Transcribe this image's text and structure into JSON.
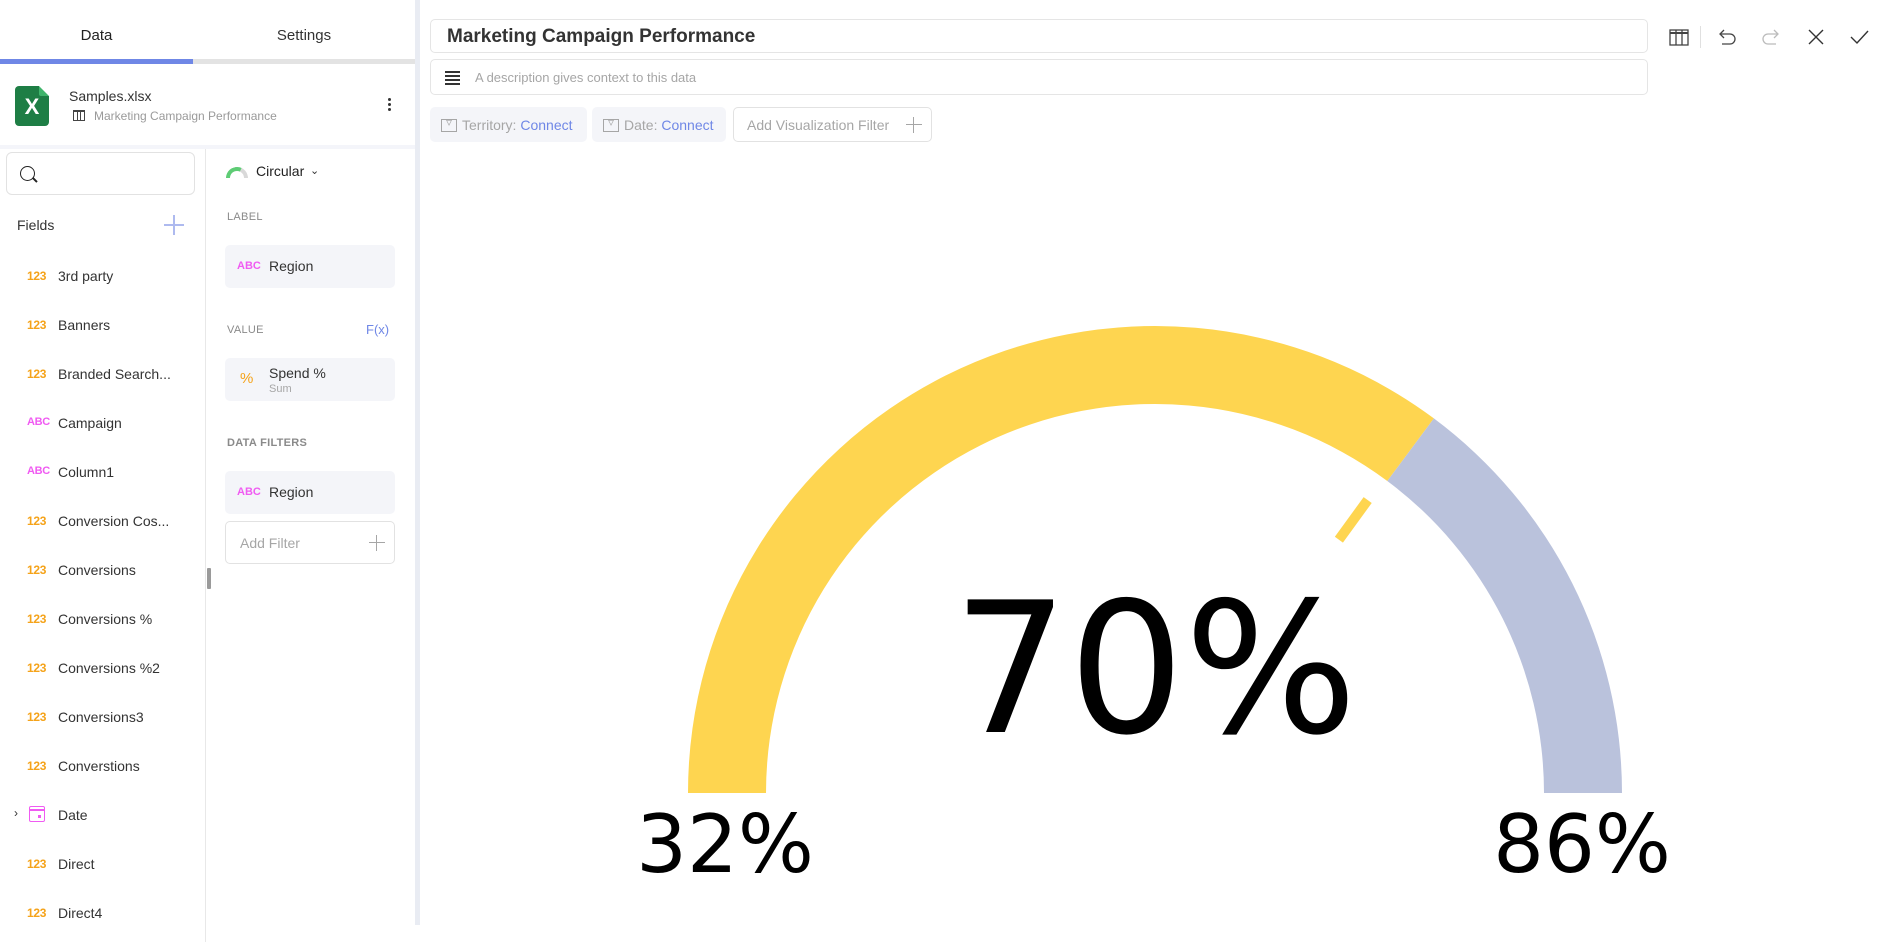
{
  "tabs": [
    {
      "label": "Data",
      "active": true
    },
    {
      "label": "Settings",
      "active": false
    }
  ],
  "source": {
    "file_name": "Samples.xlsx",
    "sheet_name": "Marketing Campaign Performance",
    "file_icon": "excel-icon",
    "sheet_icon": "table-icon",
    "menu_icon": "kebab-icon"
  },
  "fields_panel": {
    "search_placeholder": "",
    "title": "Fields",
    "add_icon": "plus-icon",
    "items": [
      {
        "type": "123",
        "name": "3rd party"
      },
      {
        "type": "123",
        "name": "Banners"
      },
      {
        "type": "123",
        "name": "Branded Search..."
      },
      {
        "type": "ABC",
        "name": "Campaign"
      },
      {
        "type": "ABC",
        "name": "Column1"
      },
      {
        "type": "123",
        "name": "Conversion Cos..."
      },
      {
        "type": "123",
        "name": "Conversions"
      },
      {
        "type": "123",
        "name": "Conversions %"
      },
      {
        "type": "123",
        "name": "Conversions %2"
      },
      {
        "type": "123",
        "name": "Conversions3"
      },
      {
        "type": "123",
        "name": "Converstions"
      },
      {
        "type": "date",
        "name": "Date",
        "expandable": true,
        "expand_glyph": "›"
      },
      {
        "type": "123",
        "name": "Direct"
      },
      {
        "type": "123",
        "name": "Direct4"
      }
    ]
  },
  "config": {
    "viz_type": "Circular",
    "viz_chevron": "⌄",
    "label_section": "LABEL",
    "label_field": {
      "type": "ABC",
      "name": "Region"
    },
    "value_section": "VALUE",
    "fx_label": "F(x)",
    "value_field": {
      "type": "%",
      "name": "Spend %",
      "aggregation": "Sum"
    },
    "data_filters_section": "DATA FILTERS",
    "data_filter_field": {
      "type": "ABC",
      "name": "Region"
    },
    "add_filter_label": "Add Filter"
  },
  "header": {
    "title": "Marketing Campaign Performance",
    "description_placeholder": "A description gives context to this data",
    "filters": [
      {
        "name": "Territory:",
        "action": "Connect"
      },
      {
        "name": "Date:",
        "action": "Connect"
      }
    ],
    "add_viz_filter_label": "Add Visualization Filter"
  },
  "toolbar": {
    "icons": [
      "table-view-icon",
      "undo-icon",
      "redo-icon",
      "close-icon",
      "check-icon"
    ]
  },
  "colors": {
    "accent": "#6f87e6",
    "gauge_fill": "#fed550",
    "gauge_remaining": "#bac2dc",
    "numeric_type": "#f5a31a",
    "text_type": "#f05bf2"
  },
  "chart_data": {
    "type": "gauge",
    "title": "",
    "min": 32,
    "max": 86,
    "value": 70,
    "target": 70,
    "min_label": "32%",
    "max_label": "86%",
    "value_label": "70%",
    "unit": "%"
  }
}
